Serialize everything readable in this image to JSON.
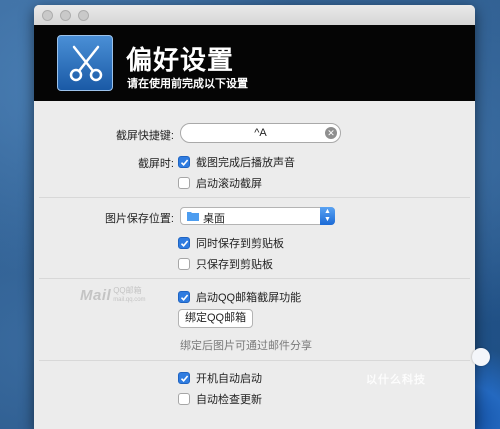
{
  "header": {
    "title": "偏好设置",
    "subtitle": "请在使用前完成以下设置"
  },
  "screenshot": {
    "hotkey_label": "截屏快捷键:",
    "hotkey_value": "^A",
    "capture_label": "截屏时:",
    "options": [
      {
        "label": "截图完成后播放声音",
        "checked": true
      },
      {
        "label": "启动滚动截屏",
        "checked": false
      }
    ]
  },
  "save": {
    "label": "图片保存位置:",
    "location": "桌面",
    "options": [
      {
        "label": "同时保存到剪贴板",
        "checked": true
      },
      {
        "label": "只保存到剪贴板",
        "checked": false
      }
    ]
  },
  "qqmail": {
    "logo_text": "Mail",
    "logo_cn": "QQ邮箱",
    "logo_sub": "mail.qq.com",
    "enable_label": "启动QQ邮箱截屏功能",
    "enable_checked": true,
    "bind_button": "绑定QQ邮箱",
    "hint": "绑定后图片可通过邮件分享"
  },
  "startup": {
    "options": [
      {
        "label": "开机自动启动",
        "checked": true
      },
      {
        "label": "自动检查更新",
        "checked": false
      }
    ]
  },
  "watermark": "以什么科技",
  "colors": {
    "accent": "#2f7ce0",
    "header_bg": "#050505",
    "window_bg": "#ececec"
  }
}
